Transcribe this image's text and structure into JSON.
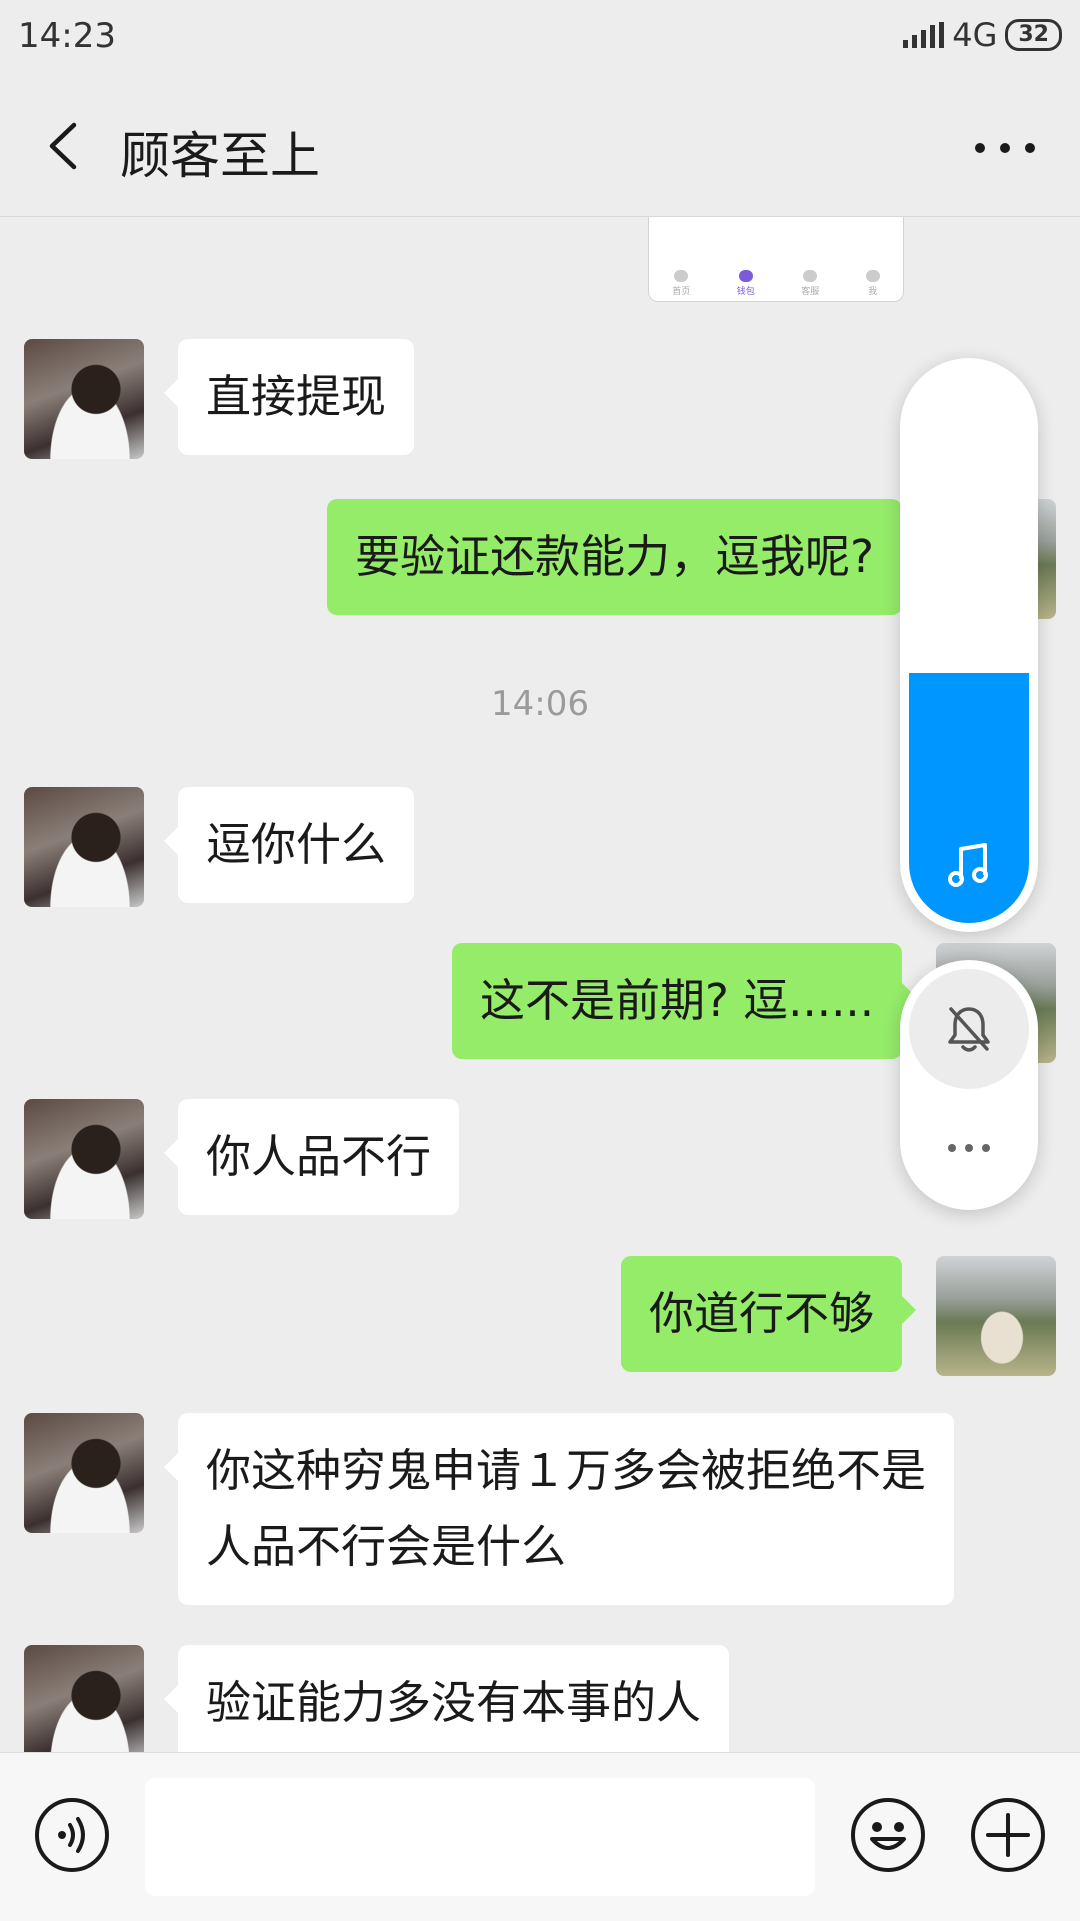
{
  "status_bar": {
    "time": "14:23",
    "network": "4G",
    "battery": "32"
  },
  "header": {
    "title": "顾客至上",
    "back_icon": "chevron-left-icon",
    "more_icon": "more-dots-icon"
  },
  "preview_card": {
    "tabs": [
      "首页",
      "钱包",
      "客服",
      "我"
    ],
    "active_tab": 1
  },
  "messages": [
    {
      "side": "in",
      "text": "直接提现"
    },
    {
      "side": "out",
      "text": "要验证还款能力，逗我呢?"
    },
    {
      "side": "time",
      "text": "14:06"
    },
    {
      "side": "in",
      "text": "逗你什么"
    },
    {
      "side": "out",
      "text": "这不是前期? 逗......"
    },
    {
      "side": "in",
      "text": "你人品不行"
    },
    {
      "side": "out",
      "text": "你道行不够"
    },
    {
      "side": "in",
      "text": "你这种穷鬼申请１万多会被拒绝不是人品不行会是什么"
    },
    {
      "side": "in",
      "text": "验证能力多没有本事的人"
    }
  ],
  "volume_overlay": {
    "level": 0.45,
    "accent": "#0096ff",
    "icons": [
      "music-note-icon",
      "bell-muted-icon",
      "more-dots-icon"
    ]
  },
  "input_bar": {
    "value": "",
    "icons": [
      "voice-icon",
      "emoji-icon",
      "plus-icon"
    ]
  },
  "colors": {
    "background": "#ededed",
    "outgoing_bubble": "#95ec69",
    "incoming_bubble": "#ffffff"
  }
}
